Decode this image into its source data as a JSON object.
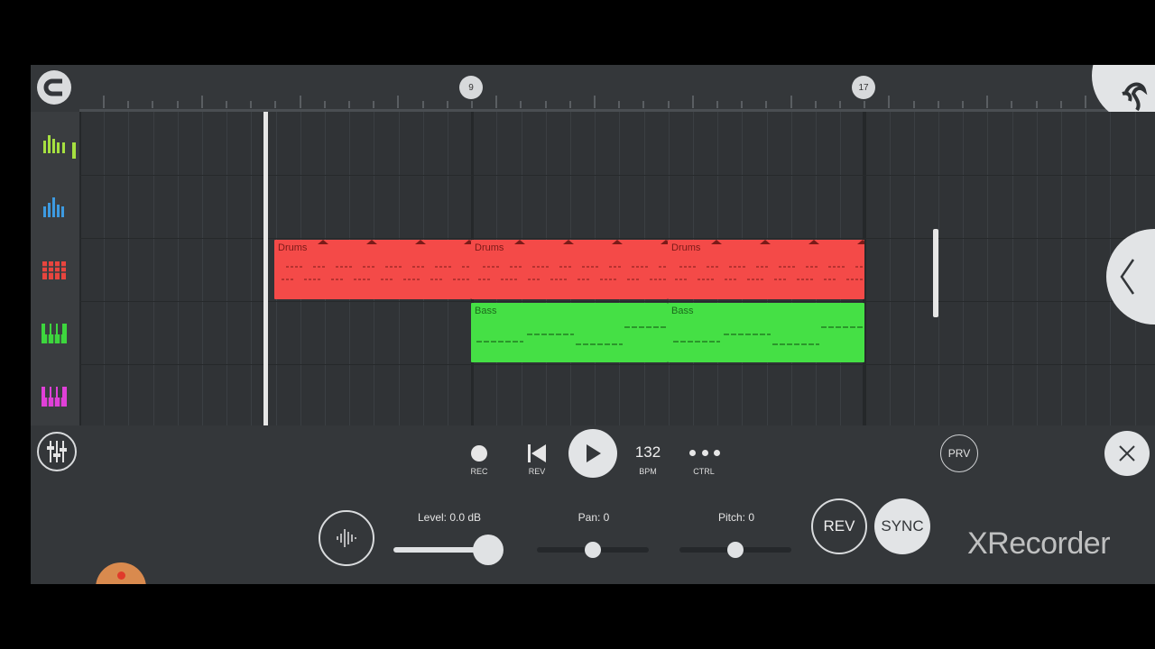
{
  "ruler": {
    "markers": [
      "9",
      "17"
    ]
  },
  "tracks": [
    {
      "name": "drums-bars-track",
      "icon": "bar-meter-icon",
      "color": "#a6e040"
    },
    {
      "name": "blue-bars-track",
      "icon": "bar-meter-icon",
      "color": "#3d9ae0"
    },
    {
      "name": "drum-pads-track",
      "icon": "drum-pad-icon",
      "color": "#e8453e"
    },
    {
      "name": "bass-keys-track",
      "icon": "piano-keys-icon",
      "color": "#3dd63d"
    },
    {
      "name": "synth-keys-track",
      "icon": "piano-keys-icon",
      "color": "#e040d8"
    }
  ],
  "clips": {
    "drums": [
      "Drums",
      "Drums",
      "Drums"
    ],
    "bass": [
      "Bass",
      "Bass"
    ]
  },
  "colors": {
    "drums": "#f44a48",
    "bass": "#45e045",
    "bg": "#34373a"
  },
  "transport": {
    "rec": "REC",
    "rev": "REV",
    "bpm_value": "132",
    "bpm": "BPM",
    "ctrl": "CTRL",
    "prv": "PRV"
  },
  "controls": {
    "level": "Level: 0.0 dB",
    "pan": "Pan: 0",
    "pitch": "Pitch: 0",
    "rev_btn": "REV",
    "sync_btn": "SYNC",
    "level_value": 1.0,
    "pan_value": 0,
    "pitch_value": 0
  },
  "watermark": "XRecorder"
}
